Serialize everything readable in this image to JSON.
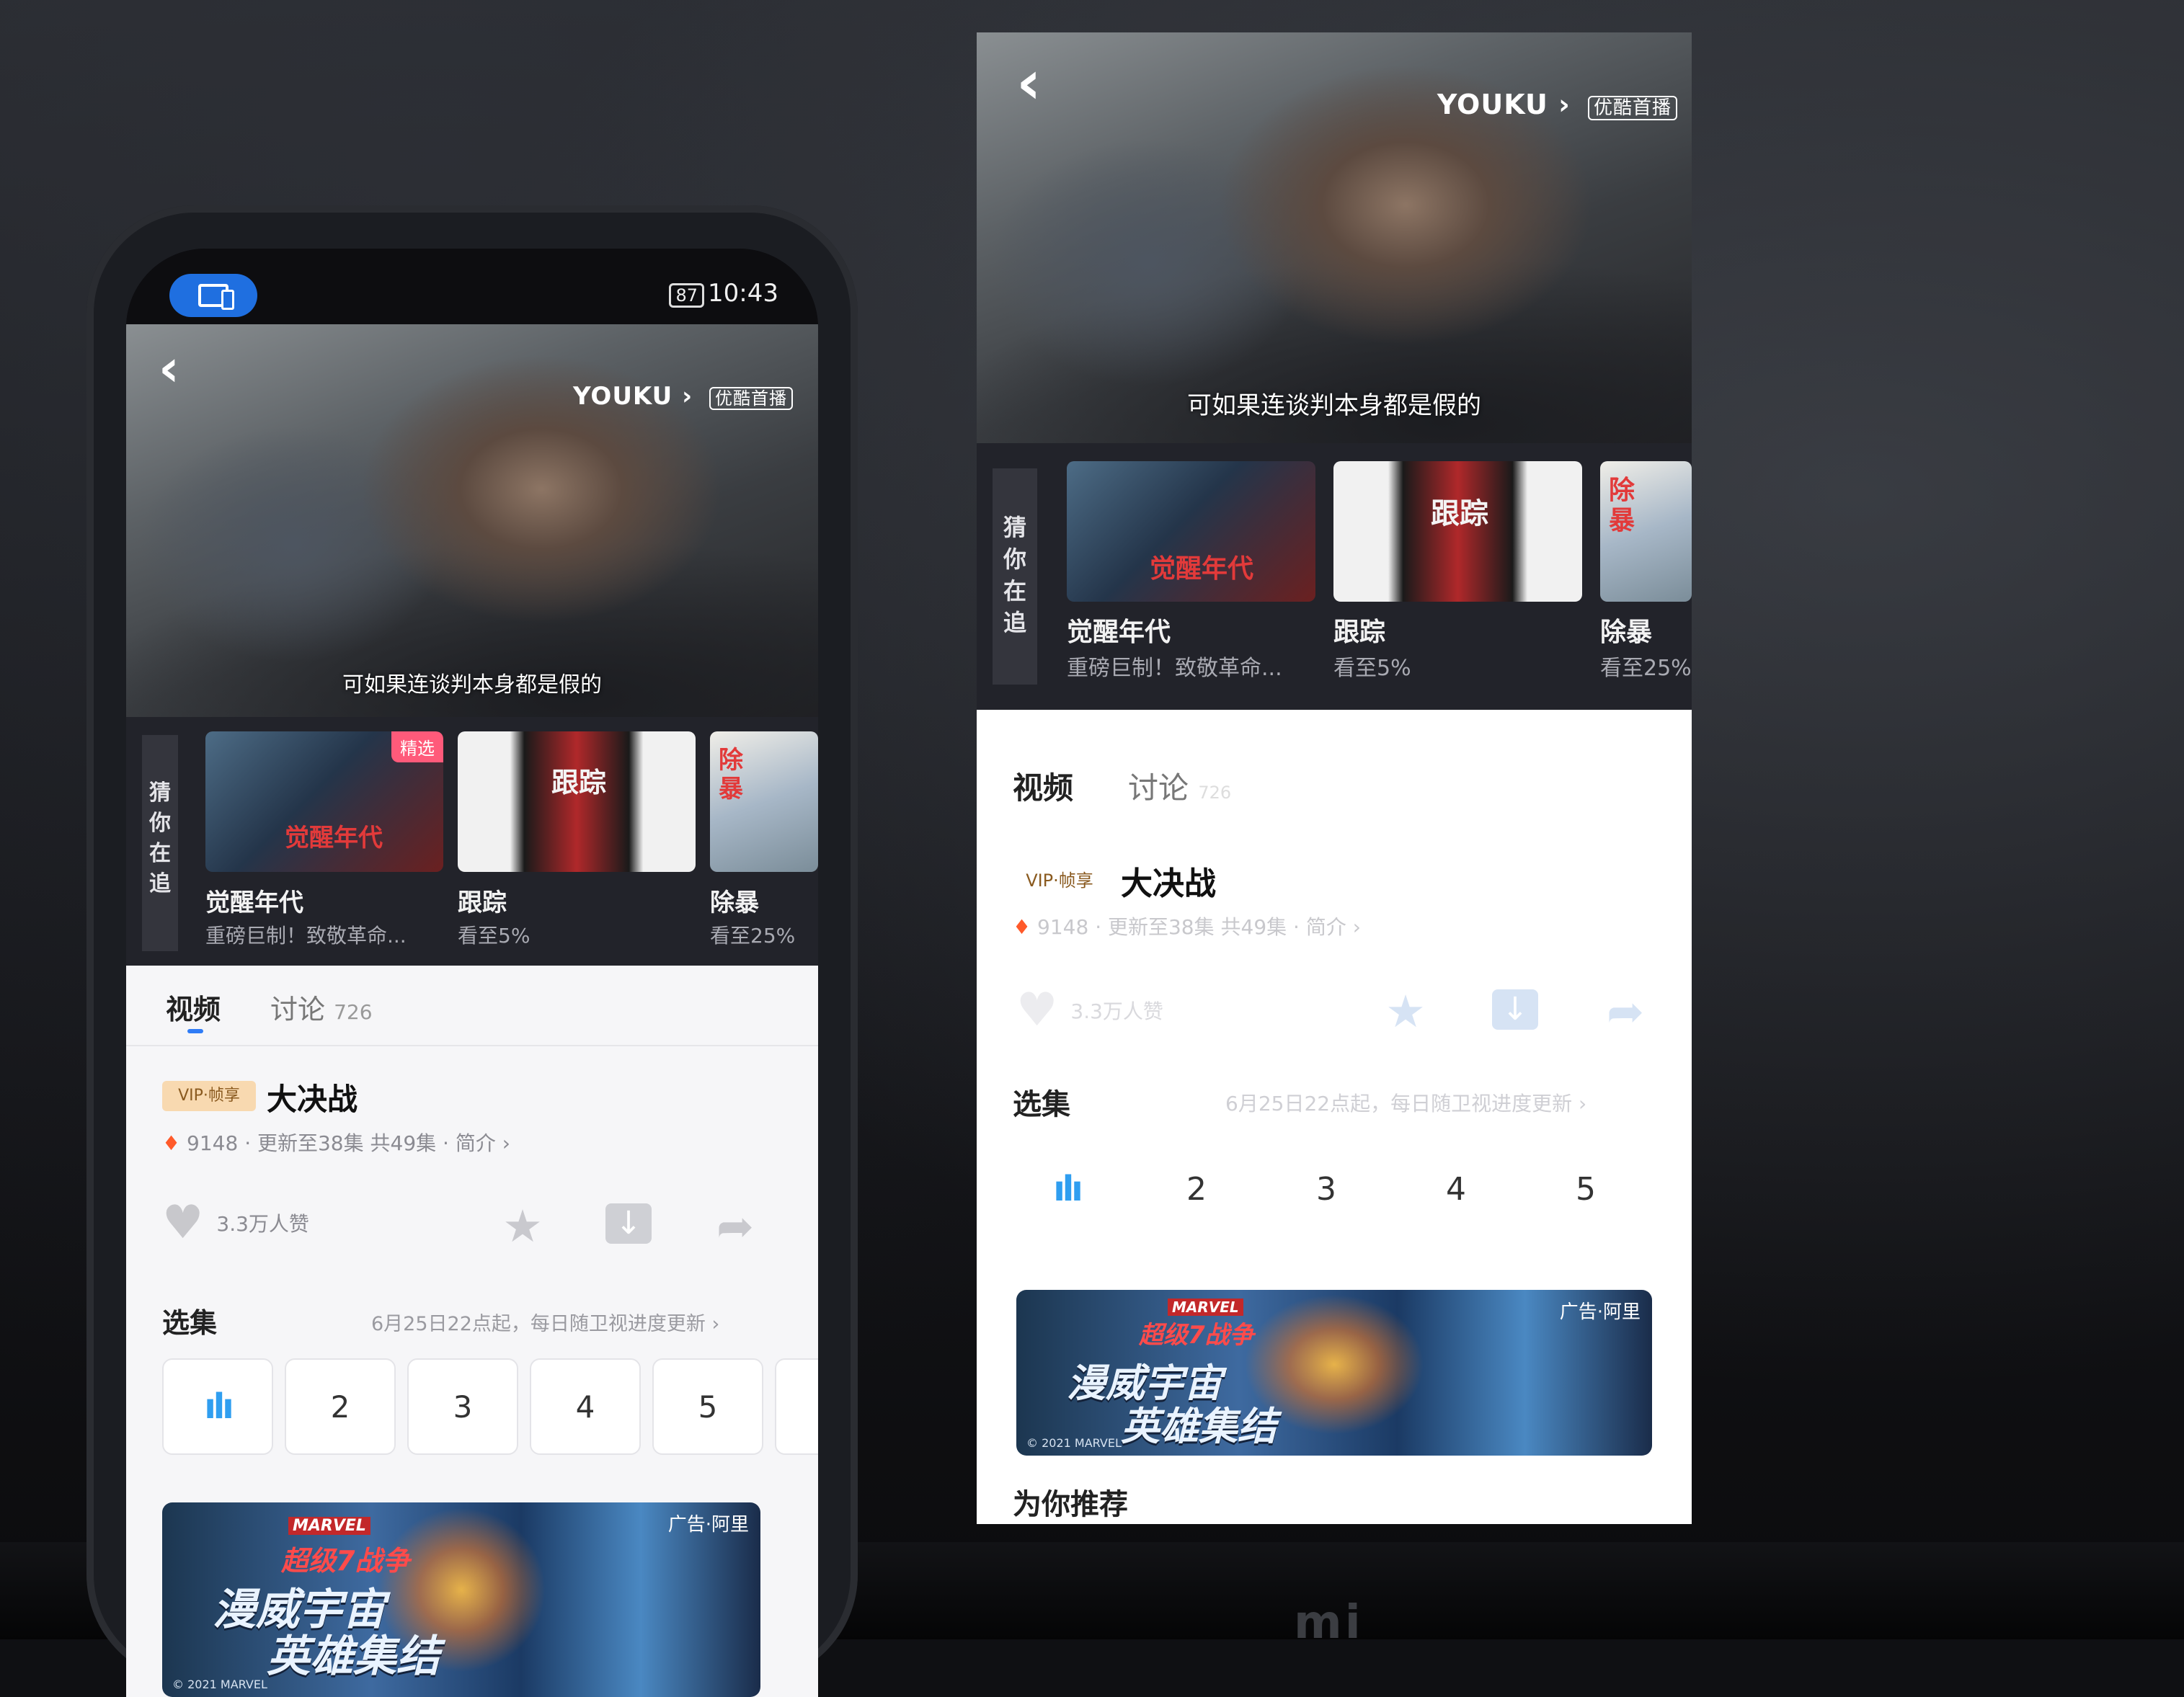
{
  "phone": {
    "status": {
      "battery": "87",
      "time": "10:43"
    },
    "player": {
      "brand": "YOUKU",
      "brand_mark": "›",
      "brand_tag": "优酷首播",
      "subtitle": "可如果连谈判本身都是假的",
      "back_glyph": "‹"
    },
    "recommend": {
      "label": "猜你在追",
      "items": [
        {
          "title": "觉醒年代",
          "subtitle": "重磅巨制！致敬革命...",
          "badge": "精选",
          "thumb_text": "觉醒年代"
        },
        {
          "title": "跟踪",
          "subtitle": "看至5%",
          "thumb_text": "跟踪"
        },
        {
          "title": "除暴",
          "subtitle": "看至25%",
          "thumb_text": "除暴"
        }
      ]
    },
    "tabs": [
      {
        "label": "视频"
      },
      {
        "label": "讨论",
        "count": "726"
      }
    ],
    "show": {
      "vip_tag": "VIP·帧享",
      "title": "大决战",
      "heat": "9148",
      "update_info": "· 更新至38集 共49集 · 简介 ›",
      "likes": "3.3万人赞"
    },
    "episodes": {
      "title": "选集",
      "note": "6月25日22点起，每日随卫视进度更新 ›",
      "playing_icon": "ılı",
      "items": [
        "2",
        "3",
        "4",
        "5"
      ]
    },
    "ad": {
      "tag": "广告·阿里",
      "logo": "MARVEL",
      "sub": "超级7战争",
      "main_line1": "漫威宇宙",
      "main_line2": "英雄集结",
      "copyright": "© 2021 MARVEL"
    }
  },
  "cast": {
    "player": {
      "brand": "YOUKU",
      "brand_mark": "›",
      "brand_tag": "优酷首播",
      "subtitle": "可如果连谈判本身都是假的",
      "back_glyph": "‹"
    },
    "recommend": {
      "label": "猜你在追",
      "items": [
        {
          "title": "觉醒年代",
          "subtitle": "重磅巨制！致敬革命...",
          "thumb_text": "觉醒年代"
        },
        {
          "title": "跟踪",
          "subtitle": "看至5%",
          "thumb_text": "跟踪"
        },
        {
          "title": "除暴",
          "subtitle": "看至25%",
          "thumb_text": "除暴"
        }
      ]
    },
    "tabs": [
      {
        "label": "视频"
      },
      {
        "label": "讨论",
        "count": "726"
      }
    ],
    "show": {
      "vip_tag": "VIP·帧享",
      "title": "大决战",
      "heat": "9148",
      "update_info": "· 更新至38集 共49集 · 简介 ›",
      "likes": "3.3万人赞"
    },
    "episodes": {
      "title": "选集",
      "note": "6月25日22点起，每日随卫视进度更新 ›",
      "playing_icon": "ılı",
      "items": [
        "2",
        "3",
        "4",
        "5"
      ]
    },
    "ad": {
      "tag": "广告·阿里",
      "logo": "MARVEL",
      "sub": "超级7战争",
      "main_line1": "漫威宇宙",
      "main_line2": "英雄集结",
      "copyright": "© 2021 MARVEL"
    },
    "section_recommend": "为你推荐"
  },
  "tv_logo": "mi"
}
